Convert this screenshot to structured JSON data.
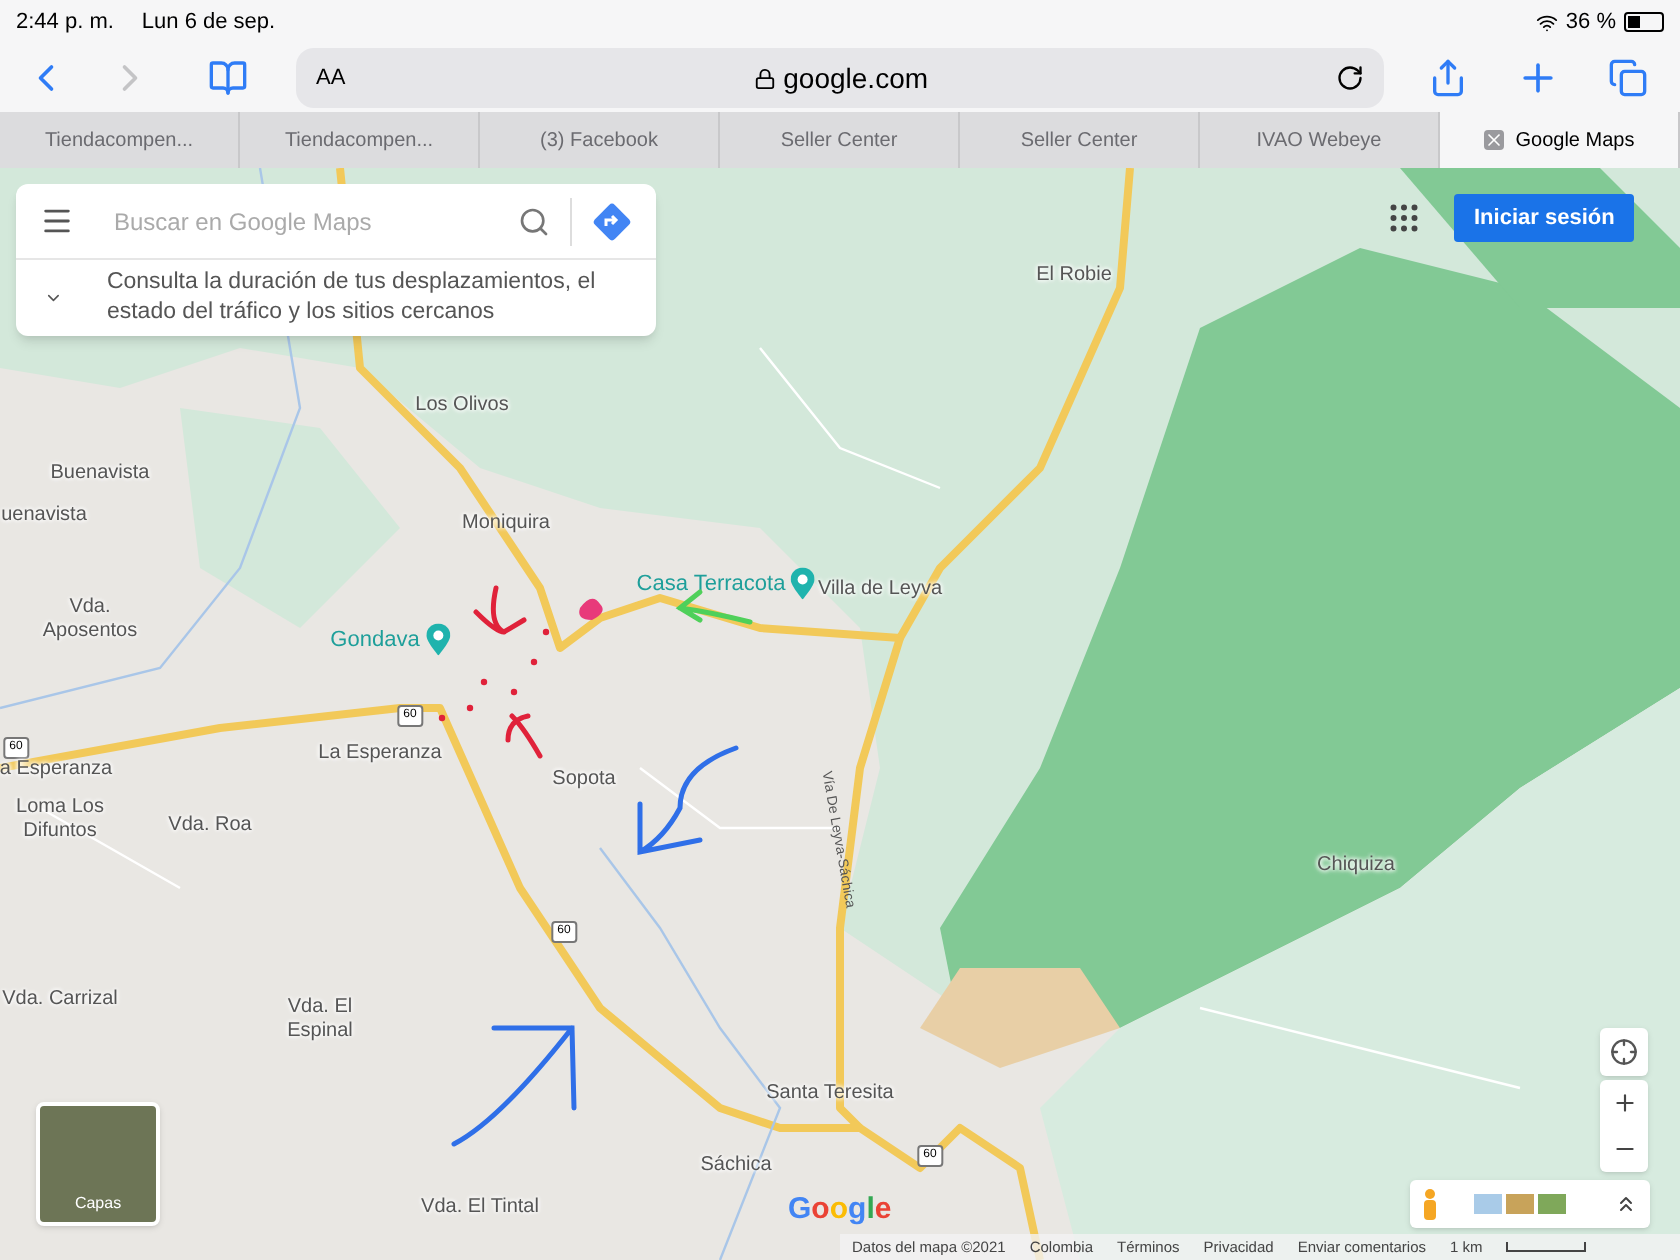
{
  "status_bar": {
    "time": "2:44 p. m.",
    "date": "Lun 6 de sep.",
    "battery": "36 %"
  },
  "toolbar": {
    "back_disabled": false,
    "forward_disabled": true,
    "text_size": "AA",
    "address": "google.com"
  },
  "tabs": [
    {
      "label": "Tiendacompen...",
      "selected": false
    },
    {
      "label": "Tiendacompen...",
      "selected": false
    },
    {
      "label": "(3) Facebook",
      "selected": false
    },
    {
      "label": "Seller Center",
      "selected": false
    },
    {
      "label": "Seller Center",
      "selected": false
    },
    {
      "label": "IVAO Webeye",
      "selected": false
    },
    {
      "label": "Google Maps",
      "selected": true
    }
  ],
  "search": {
    "placeholder": "Buscar en Google Maps",
    "hint": "Consulta la duración de tus desplazamientos, el estado del tráfico y los sitios cercanos"
  },
  "sign_in": "Iniciar sesión",
  "places": [
    {
      "label": "El Robie",
      "kind": "place"
    },
    {
      "label": "Los Olivos",
      "kind": "place"
    },
    {
      "label": "Buenavista",
      "kind": "place"
    },
    {
      "label": "uenavista",
      "kind": "place"
    },
    {
      "label": "Moniquira",
      "kind": "place"
    },
    {
      "label": "Casa Terracota",
      "kind": "poi"
    },
    {
      "label": "Villa de Leyva",
      "kind": "place"
    },
    {
      "label": "Gondava",
      "kind": "poi"
    },
    {
      "label": "Vda. Aposentos",
      "kind": "place"
    },
    {
      "label": "a Esperanza",
      "kind": "place"
    },
    {
      "label": "La Esperanza",
      "kind": "place"
    },
    {
      "label": "Sopota",
      "kind": "place"
    },
    {
      "label": "Loma Los Difuntos",
      "kind": "place"
    },
    {
      "label": "Vda. Roa",
      "kind": "place"
    },
    {
      "label": "Vda. Carrizal",
      "kind": "place"
    },
    {
      "label": "Vda. El Espinal",
      "kind": "place"
    },
    {
      "label": "Santa Teresita",
      "kind": "place"
    },
    {
      "label": "Sáchica",
      "kind": "place"
    },
    {
      "label": "Vda. El Tintal",
      "kind": "place"
    },
    {
      "label": "Chiquiza",
      "kind": "place"
    },
    {
      "label": "Vía De Leyva-Sáchica",
      "kind": "road"
    }
  ],
  "road_shields": [
    "60",
    "60",
    "60",
    "60"
  ],
  "layers_label": "Capas",
  "logo": "Google",
  "footer": [
    "Datos del mapa ©2021",
    "Colombia",
    "Términos",
    "Privacidad",
    "Enviar comentarios"
  ],
  "scale": "1 km"
}
